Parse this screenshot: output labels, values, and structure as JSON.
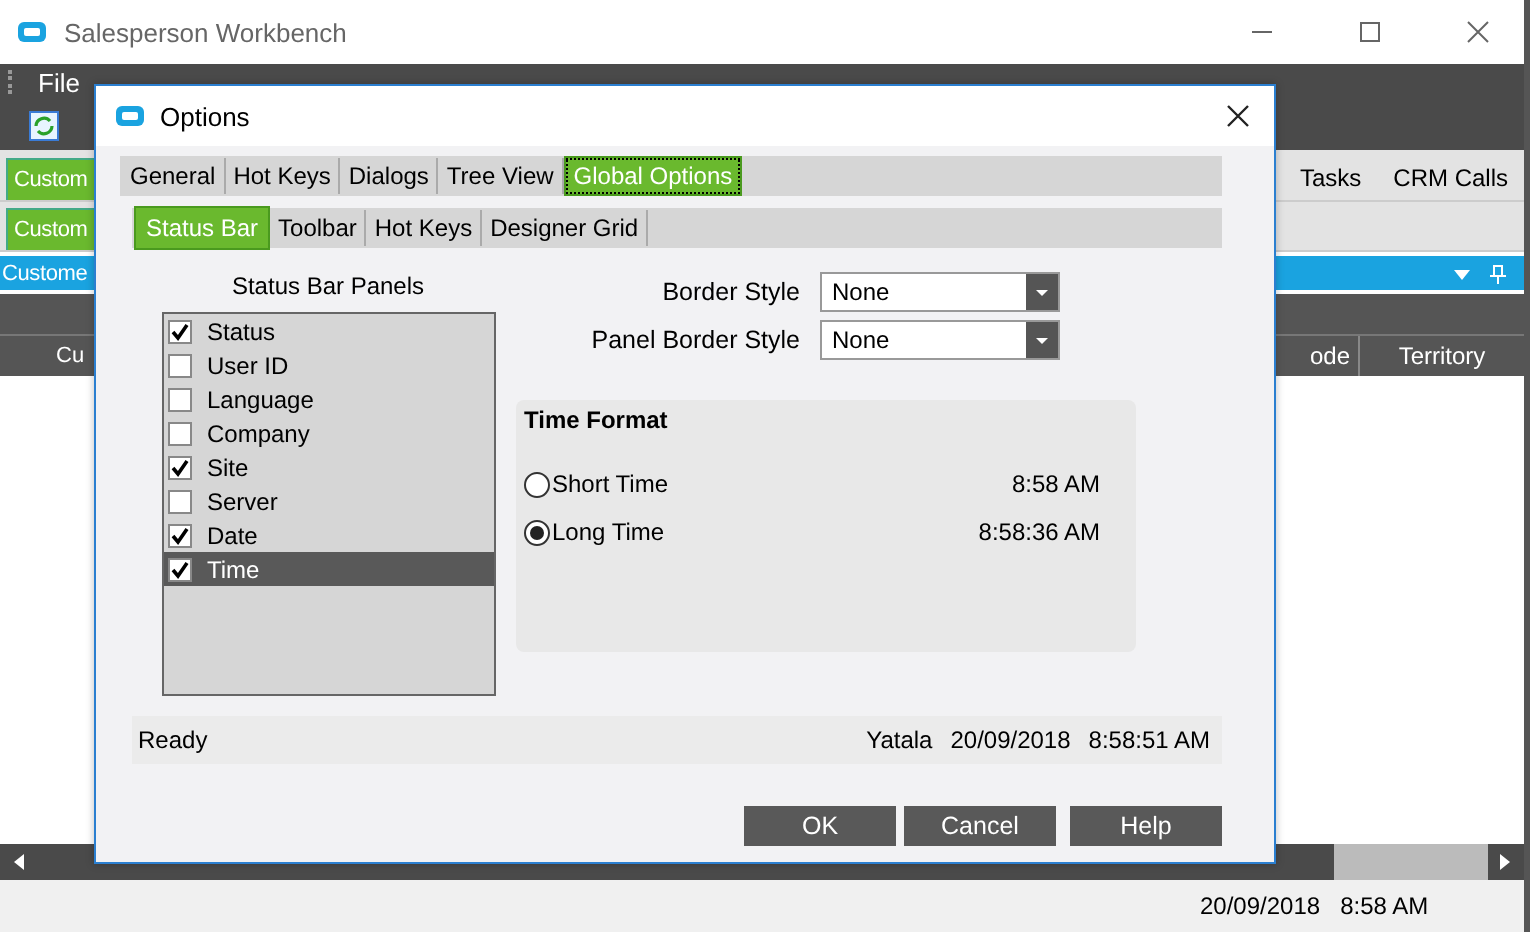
{
  "app_window": {
    "title": "Salesperson Workbench",
    "menu": [
      "File"
    ],
    "tabs_row_1": [
      {
        "label": "Custom",
        "selected": true
      },
      {
        "label": "Tasks",
        "selected": false
      },
      {
        "label": "CRM Calls",
        "selected": false
      }
    ],
    "tabs_row_2": [
      {
        "label": "Custom",
        "selected": true
      }
    ],
    "panel_title": "Custome",
    "columns": [
      "Cu",
      "ode",
      "Territory"
    ],
    "status_bar": [
      "20/09/2018",
      "8:58 AM"
    ]
  },
  "dialog": {
    "title": "Options",
    "tabs": [
      {
        "label": "General",
        "selected": false
      },
      {
        "label": "Hot Keys",
        "selected": false
      },
      {
        "label": "Dialogs",
        "selected": false
      },
      {
        "label": "Tree View",
        "selected": false
      },
      {
        "label": "Global Options",
        "selected": true
      }
    ],
    "subtabs": [
      {
        "label": "Status Bar",
        "selected": true
      },
      {
        "label": "Toolbar",
        "selected": false
      },
      {
        "label": "Hot Keys",
        "selected": false
      },
      {
        "label": "Designer Grid",
        "selected": false
      }
    ],
    "panels_label": "Status Bar Panels",
    "panels": [
      {
        "label": "Status",
        "checked": true,
        "selected": false
      },
      {
        "label": "User ID",
        "checked": false,
        "selected": false
      },
      {
        "label": "Language",
        "checked": false,
        "selected": false
      },
      {
        "label": "Company",
        "checked": false,
        "selected": false
      },
      {
        "label": "Site",
        "checked": true,
        "selected": false
      },
      {
        "label": "Server",
        "checked": false,
        "selected": false
      },
      {
        "label": "Date",
        "checked": true,
        "selected": false
      },
      {
        "label": "Time",
        "checked": true,
        "selected": true
      }
    ],
    "fields": [
      {
        "label": "Border Style",
        "value": "None"
      },
      {
        "label": "Panel Border Style",
        "value": "None"
      }
    ],
    "time_format": {
      "title": "Time Format",
      "options": [
        {
          "label": "Short Time",
          "example": "8:58 AM",
          "selected": false
        },
        {
          "label": "Long Time",
          "example": "8:58:36 AM",
          "selected": true
        }
      ]
    },
    "preview_status": {
      "left": "Ready",
      "right": [
        "Yatala",
        "20/09/2018",
        "8:58:51 AM"
      ]
    },
    "buttons": [
      "OK",
      "Cancel",
      "Help"
    ]
  }
}
